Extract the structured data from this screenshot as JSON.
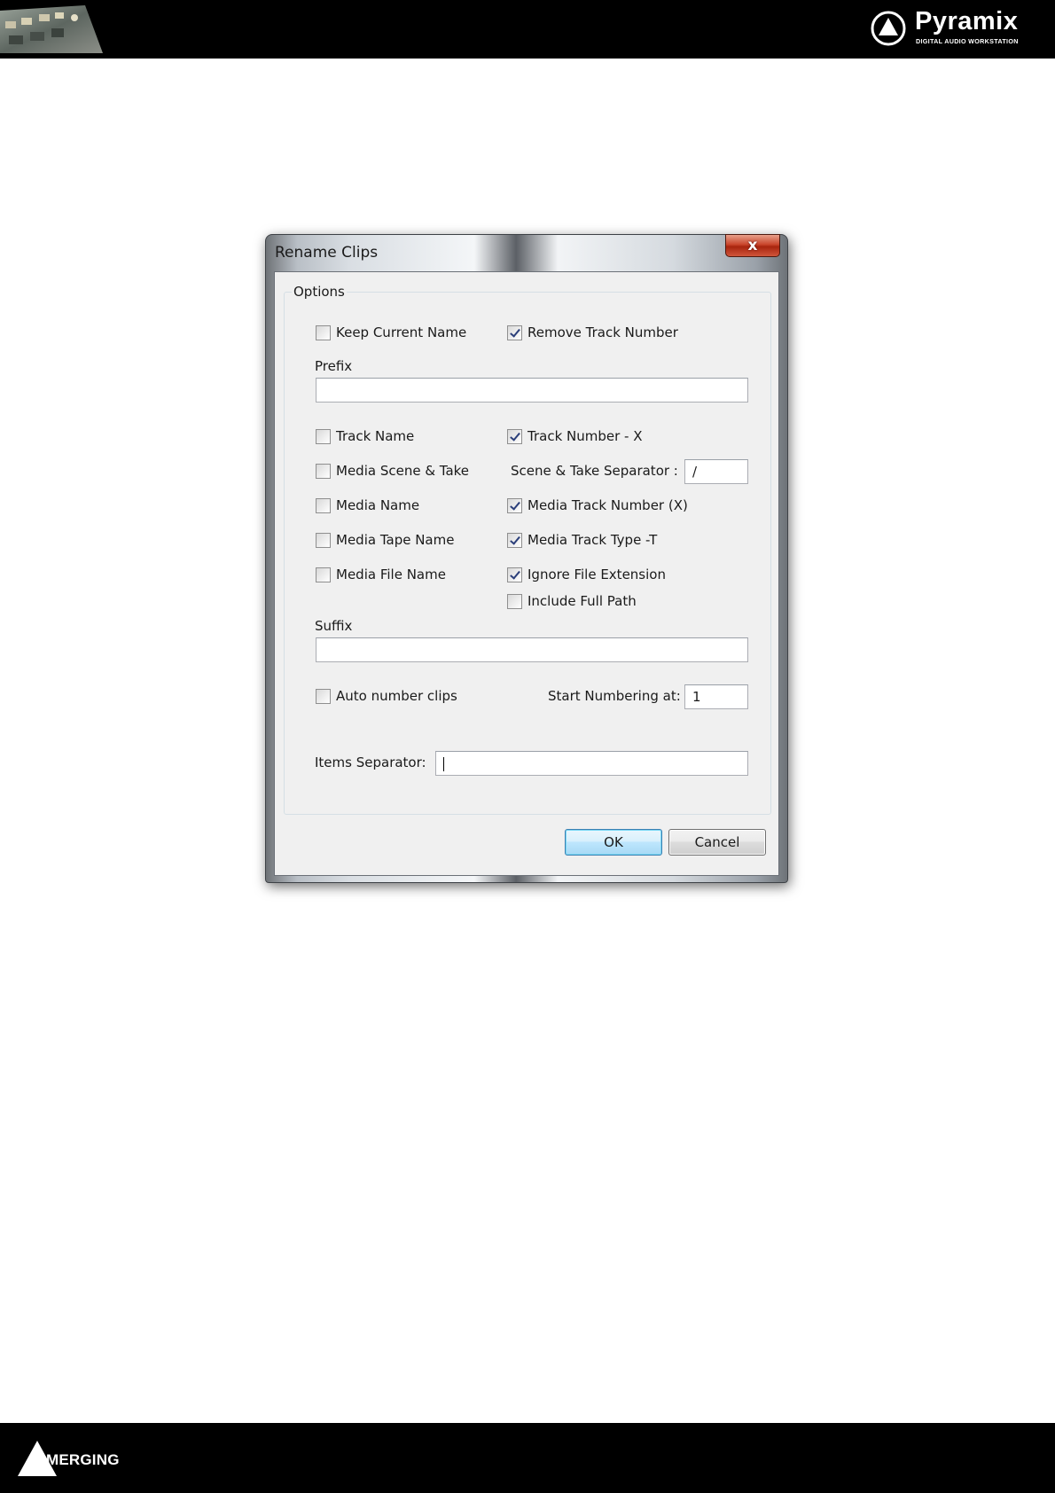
{
  "header": {
    "brand_name": "Pyramix",
    "brand_tagline": "DIGITAL AUDIO WORKSTATION"
  },
  "footer": {
    "company_name": "MERGING"
  },
  "dialog": {
    "title": "Rename Clips",
    "close_label": "x",
    "options_group_title": "Options",
    "keep_current_name": {
      "label": "Keep Current Name",
      "checked": false
    },
    "remove_track_number": {
      "label": "Remove Track Number",
      "checked": true
    },
    "prefix_label": "Prefix",
    "prefix_value": "",
    "track_name": {
      "label": "Track Name",
      "checked": false
    },
    "track_number_x": {
      "label": "Track Number - X",
      "checked": true
    },
    "media_scene_take": {
      "label": "Media Scene & Take",
      "checked": false
    },
    "scene_take_separator_label": "Scene & Take Separator :",
    "scene_take_separator_value": "/",
    "media_name": {
      "label": "Media Name",
      "checked": false
    },
    "media_track_number": {
      "label": "Media Track Number (X)",
      "checked": true
    },
    "media_tape_name": {
      "label": "Media Tape Name",
      "checked": false
    },
    "media_track_type": {
      "label": "Media Track Type -T",
      "checked": true
    },
    "media_file_name": {
      "label": "Media File Name",
      "checked": false
    },
    "ignore_file_extension": {
      "label": "Ignore File Extension",
      "checked": true
    },
    "include_full_path": {
      "label": "Include Full Path",
      "checked": false
    },
    "suffix_label": "Suffix",
    "suffix_value": "",
    "auto_number_clips": {
      "label": "Auto number clips",
      "checked": false
    },
    "start_numbering_label": "Start Numbering at:",
    "start_numbering_value": "1",
    "items_separator_label": "Items Separator:",
    "items_separator_value": "",
    "ok_label": "OK",
    "cancel_label": "Cancel"
  },
  "colors": {
    "header_bg": "#000000",
    "dialog_client_bg": "#f0f0f0",
    "ok_button_border": "#3c7fb1",
    "close_button": "#c9452c"
  }
}
